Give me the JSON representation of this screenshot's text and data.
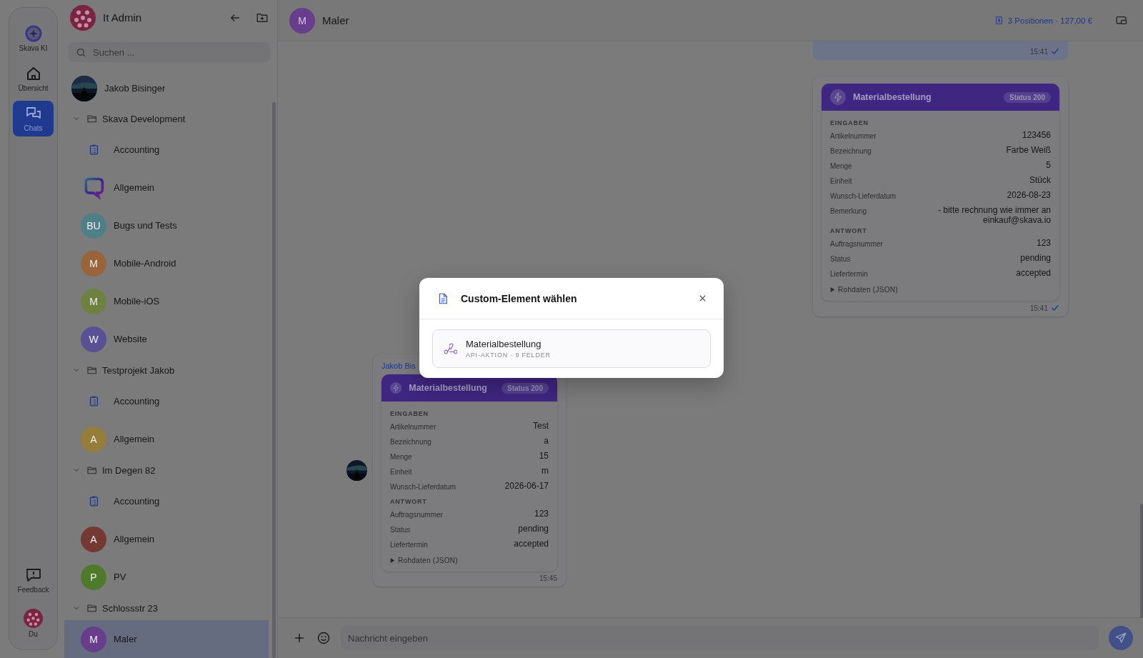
{
  "rail": {
    "items": [
      {
        "kind": "ai",
        "label": "Skava KI",
        "selected": false
      },
      {
        "kind": "home",
        "label": "Übersicht",
        "selected": false
      },
      {
        "kind": "chats",
        "label": "Chats",
        "selected": true
      }
    ],
    "bottom": [
      {
        "kind": "feedback",
        "label": "Feedback"
      },
      {
        "kind": "profile",
        "label": "Du"
      }
    ]
  },
  "sidebar": {
    "title": "It Admin",
    "search": {
      "placeholder": "Suchen ..."
    },
    "items": [
      {
        "kind": "person",
        "name": "Jakob Bisinger",
        "selected": false
      },
      {
        "kind": "folder",
        "name": "Skava Development",
        "expanded": true,
        "children": [
          {
            "kind": "channel",
            "name": "Accounting",
            "selected": false
          },
          {
            "kind": "logo",
            "name": "Allgemein",
            "selected": false
          },
          {
            "kind": "letter",
            "initials": "BU",
            "name": "Bugs und Tests",
            "color": "#4f7f87",
            "selected": false
          },
          {
            "kind": "letter",
            "initials": "M",
            "name": "Mobile-Android",
            "color": "#9a643a",
            "selected": false
          },
          {
            "kind": "letter",
            "initials": "M",
            "name": "Mobile-iOS",
            "color": "#6f8140",
            "selected": false
          },
          {
            "kind": "letter",
            "initials": "W",
            "name": "Website",
            "color": "#5a5096",
            "selected": false
          }
        ]
      },
      {
        "kind": "folder",
        "name": "Testprojekt Jakob",
        "expanded": true,
        "children": [
          {
            "kind": "channel",
            "name": "Accounting",
            "selected": false
          },
          {
            "kind": "letter",
            "initials": "A",
            "name": "Allgemein",
            "color": "#957d3a",
            "selected": false
          }
        ]
      },
      {
        "kind": "folder",
        "name": "Im Degen 82",
        "expanded": true,
        "children": [
          {
            "kind": "channel",
            "name": "Accounting",
            "selected": false
          },
          {
            "kind": "letter",
            "initials": "A",
            "name": "Allgemein",
            "color": "#743a32",
            "selected": false
          },
          {
            "kind": "letter",
            "initials": "P",
            "name": "PV",
            "color": "#4f7a2c",
            "selected": false
          }
        ]
      },
      {
        "kind": "folder",
        "name": "Schlossstr 23",
        "expanded": true,
        "children": [
          {
            "kind": "letter",
            "initials": "M",
            "name": "Maler",
            "color": "#683d8c",
            "selected": true
          }
        ]
      }
    ]
  },
  "chat": {
    "initials": "M",
    "title": "Maler",
    "summary": "3 Positionen · 127,00 €",
    "messages": [
      {
        "kind": "tail",
        "outgoing": true,
        "time": "15:41",
        "read": true
      },
      {
        "kind": "card",
        "outgoing": true,
        "time": "15:41",
        "read": true,
        "card": {
          "title": "Materialbestellung",
          "status": "Status 200",
          "sections": [
            {
              "heading": "EINGABEN",
              "rows": [
                {
                  "label": "Artikelnummer",
                  "value": "123456"
                },
                {
                  "label": "Bezeichnung",
                  "value": "Farbe Weiß"
                },
                {
                  "label": "Menge",
                  "value": "5"
                },
                {
                  "label": "Einheit",
                  "value": "Stück"
                },
                {
                  "label": "Wunsch-Lieferdatum",
                  "value": "2026-08-23"
                },
                {
                  "label": "Bemerkung",
                  "value": "- bitte rechnung wie immer an einkauf@skava.io"
                }
              ]
            },
            {
              "heading": "ANTWORT",
              "rows": [
                {
                  "label": "Auftragsnummer",
                  "value": "123"
                },
                {
                  "label": "Status",
                  "value": "pending"
                },
                {
                  "label": "Liefertermin",
                  "value": "accepted"
                }
              ]
            }
          ],
          "raw": "Rohdaten (JSON)",
          "expanded": false
        }
      },
      {
        "kind": "card",
        "outgoing": false,
        "sender": "Jakob Bis",
        "time": "15:45",
        "read": false,
        "card": {
          "title": "Materialbestellung",
          "status": "Status 200",
          "sections": [
            {
              "heading": "EINGABEN",
              "rows": [
                {
                  "label": "Artikelnummer",
                  "value": "Test"
                },
                {
                  "label": "Bezeichnung",
                  "value": "a"
                },
                {
                  "label": "Menge",
                  "value": "15"
                },
                {
                  "label": "Einheit",
                  "value": "m"
                },
                {
                  "label": "Wunsch-Lieferdatum",
                  "value": "2026-06-17"
                }
              ]
            },
            {
              "heading": "ANTWORT",
              "rows": [
                {
                  "label": "Auftragsnummer",
                  "value": "123"
                },
                {
                  "label": "Status",
                  "value": "pending"
                },
                {
                  "label": "Liefertermin",
                  "value": "accepted"
                }
              ]
            }
          ],
          "raw": "Rohdaten (JSON)",
          "expanded": false
        }
      }
    ],
    "composer": {
      "placeholder": "Nachricht eingeben"
    }
  },
  "modal": {
    "title": "Custom-Element wählen",
    "options": [
      {
        "title": "Materialbestellung",
        "subtitle": "API-AKTION · 9 FELDER",
        "selected": false
      }
    ]
  }
}
